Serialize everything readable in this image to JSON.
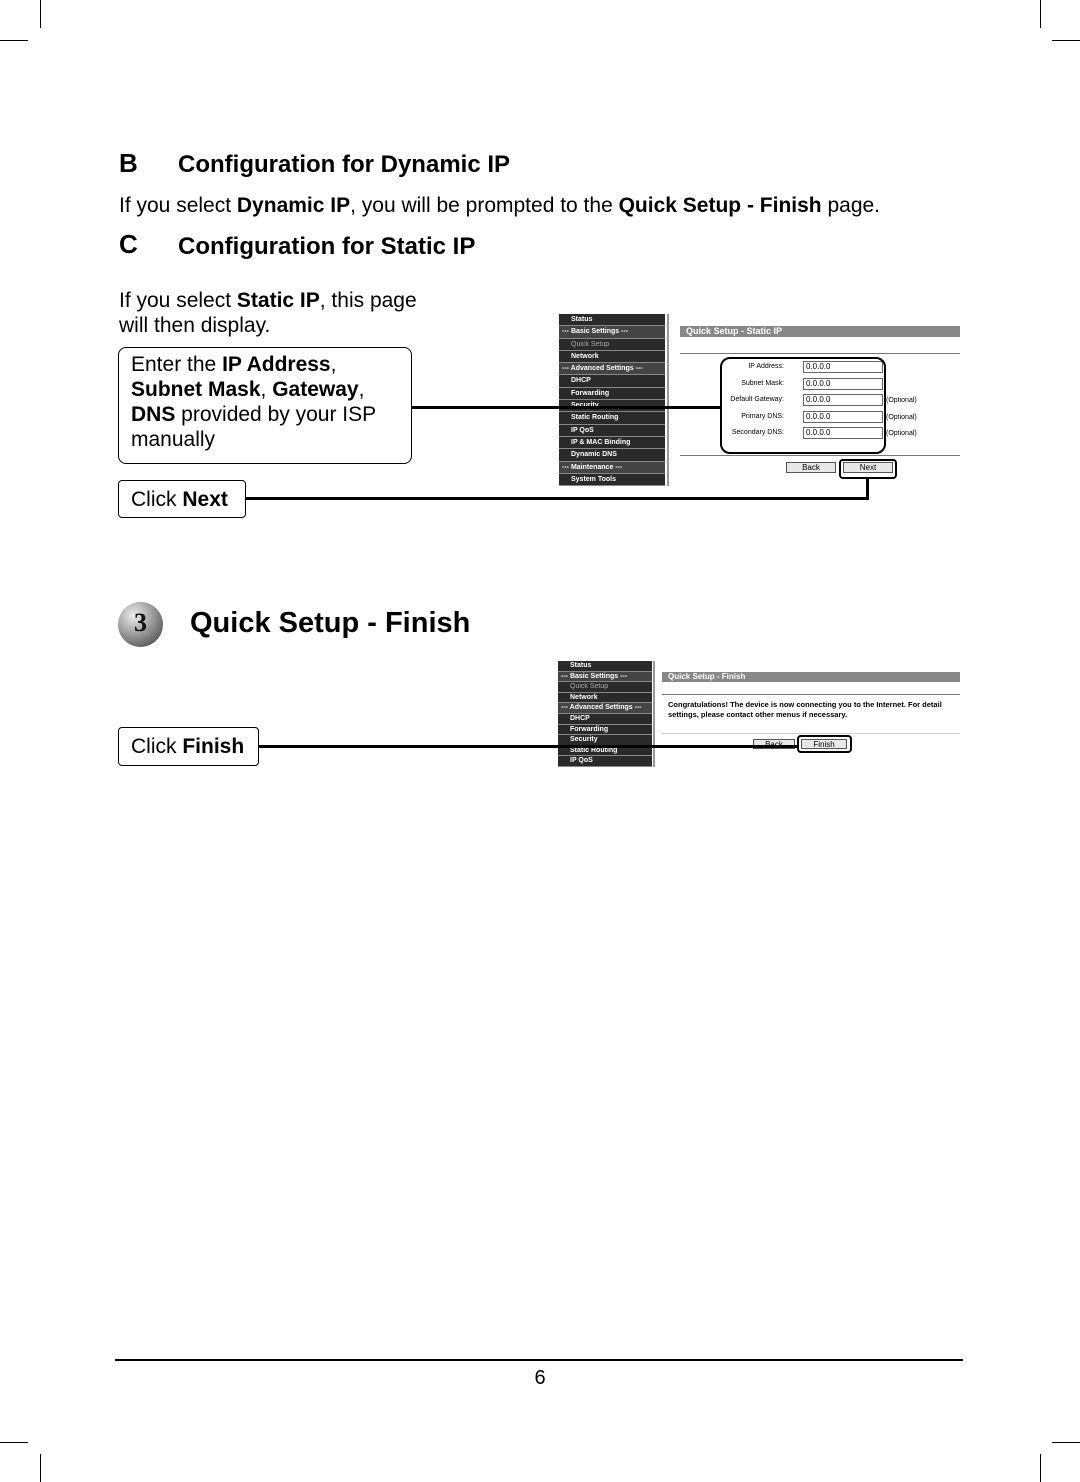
{
  "section_b": {
    "letter": "B",
    "title": "Configuration for Dynamic IP",
    "text_1": "If you select ",
    "bold_1": "Dynamic IP",
    "text_2": ", you will be prompted to the ",
    "bold_2": "Quick Setup - Finish",
    "text_3": " page."
  },
  "section_c": {
    "letter": "C",
    "title": "Configuration for Static IP",
    "intro_1": "If you select ",
    "intro_bold": "Static IP",
    "intro_2": ", this page",
    "intro_3": "will then display.",
    "callout": {
      "t1": "Enter the ",
      "b1": "IP Address",
      "t2": ",",
      "b2": "Subnet Mask",
      "t3": ", ",
      "b3": "Gateway",
      "t4": ",",
      "b4": "DNS",
      "t5": " provided by your ISP",
      "t6": "manually"
    },
    "click": {
      "t": "Click ",
      "b": "Next"
    },
    "screenshot": {
      "sidebar": [
        "Status",
        "--- Basic Settings ---",
        "Quick Setup",
        "Network",
        "--- Advanced Settings ---",
        "DHCP",
        "Forwarding",
        "Security",
        "Static Routing",
        "IP QoS",
        "IP & MAC Binding",
        "Dynamic DNS",
        "--- Maintenance ---",
        "System Tools"
      ],
      "title": "Quick Setup - Static IP",
      "fields": [
        {
          "label": "IP Address:",
          "value": "0.0.0.0",
          "note": ""
        },
        {
          "label": "Subnet Mask:",
          "value": "0.0.0.0",
          "note": ""
        },
        {
          "label": "Default Gateway:",
          "value": "0.0.0.0",
          "note": "(Optional)"
        },
        {
          "label": "Primary DNS:",
          "value": "0.0.0.0",
          "note": "(Optional)"
        },
        {
          "label": "Secondary DNS:",
          "value": "0.0.0.0",
          "note": "(Optional)"
        }
      ],
      "back": "Back",
      "next": "Next"
    }
  },
  "step3": {
    "number": "3",
    "title": "Quick Setup - Finish",
    "click": {
      "t": "Click ",
      "b": "Finish"
    },
    "screenshot": {
      "sidebar": [
        "Status",
        "--- Basic Settings ---",
        "Quick Setup",
        "Network",
        "--- Advanced Settings ---",
        "DHCP",
        "Forwarding",
        "Security",
        "Static Routing",
        "IP QoS"
      ],
      "title": "Quick Setup - Finish",
      "message": "Congratulations! The device is now connecting you to the Internet. For detail settings, please contact other menus if necessary.",
      "back": "Back",
      "finish": "Finish"
    }
  },
  "footer": {
    "page_number": "6"
  }
}
